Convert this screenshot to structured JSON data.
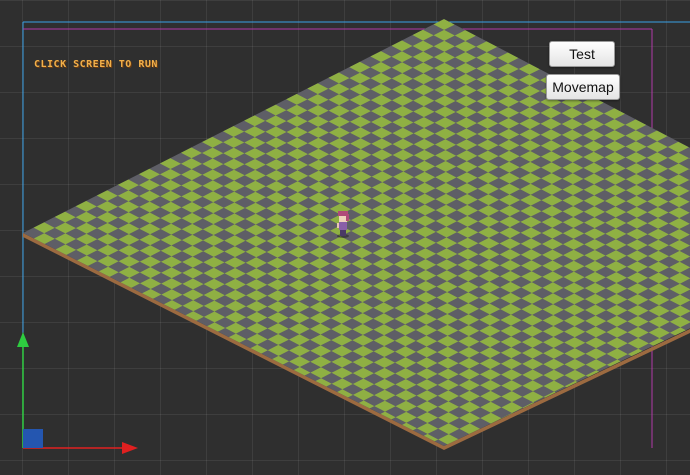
{
  "hud": {
    "message": "CLICK SCREEN TO RUN"
  },
  "buttons": {
    "test_label": "Test",
    "movemap_label": "Movemap"
  },
  "colors": {
    "tile_green": "#8fb043",
    "tile_gray": "#5e5e66",
    "map_edge": "#9c6a40",
    "frame_blue": "#3aa0e6",
    "frame_magenta": "#b23aa8",
    "axis_y": "#2ecc40",
    "axis_x": "#e02020",
    "origin": "#2456b0",
    "hud_text": "#f2b04a"
  },
  "icons": {
    "y_axis": "y-axis-arrow-icon",
    "x_axis": "x-axis-arrow-icon",
    "origin": "origin-square-icon"
  }
}
